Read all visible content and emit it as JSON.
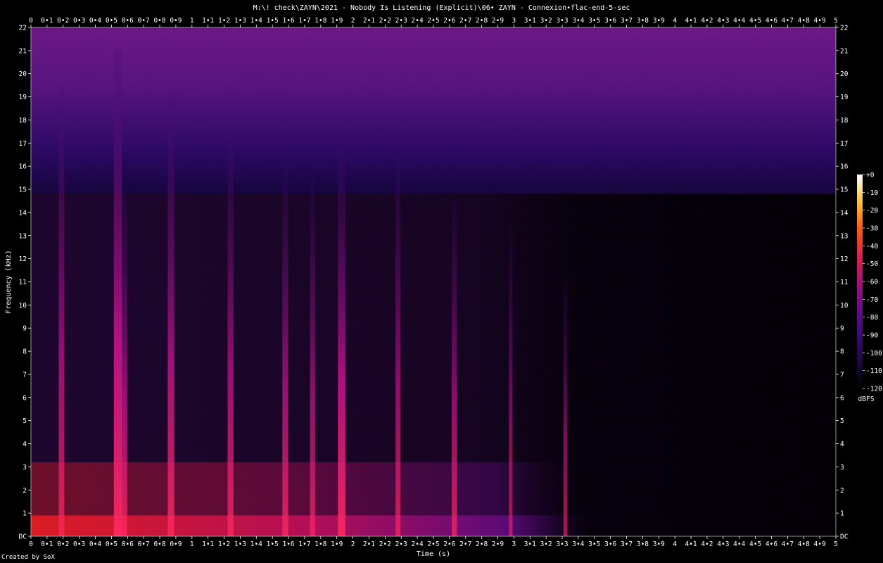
{
  "chart_data": {
    "type": "heatmap",
    "title": "M:\\! check\\ZAYN\\2021 - Nobody Is Listening (Explicit)\\06• ZAYN - Connexion•flac-end-5-sec",
    "xlabel": "Time (s)",
    "ylabel": "Frequency (kHz)",
    "xlim": [
      0,
      5
    ],
    "ylim": [
      0,
      22
    ],
    "x_ticks": [
      "0",
      "0•1",
      "0•2",
      "0•3",
      "0•4",
      "0•5",
      "0•6",
      "0•7",
      "0•8",
      "0•9",
      "1",
      "1•1",
      "1•2",
      "1•3",
      "1•4",
      "1•5",
      "1•6",
      "1•7",
      "1•8",
      "1•9",
      "2",
      "2•1",
      "2•2",
      "2•3",
      "2•4",
      "2•5",
      "2•6",
      "2•7",
      "2•8",
      "2•9",
      "3",
      "3•1",
      "3•2",
      "3•3",
      "3•4",
      "3•5",
      "3•6",
      "3•7",
      "3•8",
      "3•9",
      "4",
      "4•1",
      "4•2",
      "4•3",
      "4•4",
      "4•5",
      "4•6",
      "4•7",
      "4•8",
      "4•9",
      "5"
    ],
    "y_ticks": [
      "DC",
      "1",
      "2",
      "3",
      "4",
      "5",
      "6",
      "7",
      "8",
      "9",
      "10",
      "11",
      "12",
      "13",
      "14",
      "15",
      "16",
      "17",
      "18",
      "19",
      "20",
      "21",
      "22"
    ],
    "colorbar": {
      "unit": "dBFS",
      "range": [
        -120,
        0
      ],
      "ticks": [
        "+0",
        "-10",
        "-20",
        "-30",
        "-40",
        "-50",
        "-60",
        "-70",
        "-80",
        "-90",
        "-100",
        "-110",
        "-120"
      ]
    },
    "noise_floor_cutoff_khz": 14.8,
    "transients": [
      {
        "t": 0.19,
        "top_khz": 19.5,
        "level": 0.55
      },
      {
        "t": 0.54,
        "top_khz": 21.0,
        "level": 0.95
      },
      {
        "t": 0.58,
        "top_khz": 15.0,
        "level": 0.6
      },
      {
        "t": 0.87,
        "top_khz": 19.0,
        "level": 0.7
      },
      {
        "t": 1.24,
        "top_khz": 17.5,
        "level": 0.6
      },
      {
        "t": 1.58,
        "top_khz": 16.0,
        "level": 0.6
      },
      {
        "t": 1.75,
        "top_khz": 15.5,
        "level": 0.5
      },
      {
        "t": 1.93,
        "top_khz": 16.8,
        "level": 0.85
      },
      {
        "t": 2.28,
        "top_khz": 16.5,
        "level": 0.45
      },
      {
        "t": 2.63,
        "top_khz": 14.5,
        "level": 0.5
      },
      {
        "t": 2.98,
        "top_khz": 13.5,
        "level": 0.25
      },
      {
        "t": 3.32,
        "top_khz": 11.0,
        "level": 0.3
      }
    ],
    "low_band_energy_end_s": 3.4,
    "colors": {
      "background": "#000000",
      "text": "#ffffff"
    }
  },
  "credit": "Created by SoX"
}
